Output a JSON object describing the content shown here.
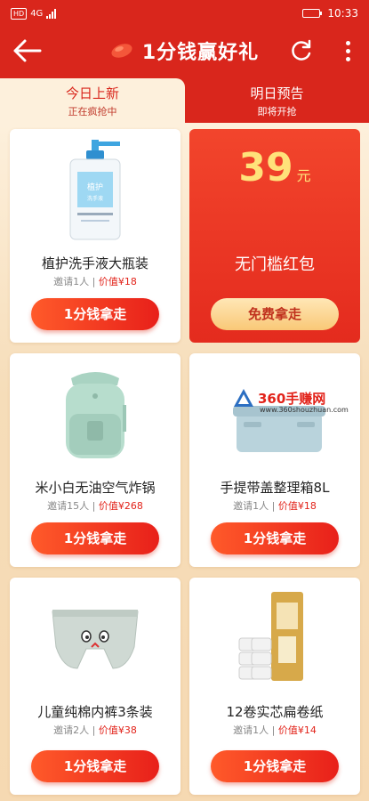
{
  "status_bar": {
    "hd": "HD",
    "network": "4G",
    "time": "10:33",
    "battery_level": 0.9
  },
  "header": {
    "title": "1分钱赢好礼",
    "back_icon": "back-arrow-icon",
    "refresh_icon": "refresh-icon",
    "more_icon": "more-vertical-icon"
  },
  "tabs": [
    {
      "title": "今日上新",
      "subtitle": "正在疯抢中"
    },
    {
      "title": "明日预告",
      "subtitle": "即将开抢"
    }
  ],
  "products": [
    {
      "name": "植护洗手液大瓶装",
      "invite": "邀请1人",
      "price": "价值¥18",
      "button": "1分钱拿走"
    },
    {
      "name": "米小白无油空气炸锅",
      "invite": "邀请15人",
      "price": "价值¥268",
      "button": "1分钱拿走"
    },
    {
      "name": "手提带盖整理箱8L",
      "invite": "邀请1人",
      "price": "价值¥18",
      "button": "1分钱拿走"
    },
    {
      "name": "儿童纯棉内裤3条装",
      "invite": "邀请2人",
      "price": "价值¥38",
      "button": "1分钱拿走"
    },
    {
      "name": "12卷实芯扁卷纸",
      "invite": "邀请1人",
      "price": "价值¥14",
      "button": "1分钱拿走"
    }
  ],
  "red_packet": {
    "amount": "39",
    "unit": "元",
    "label": "无门槛红包",
    "button": "免费拿走"
  },
  "watermark": {
    "text": "360手赚网",
    "url": "www.360shouzhuan.com"
  },
  "colors": {
    "primary_red": "#d9261c",
    "price_red": "#e2231a",
    "gold": "#ffe27a",
    "background": "#f6ddb9"
  }
}
